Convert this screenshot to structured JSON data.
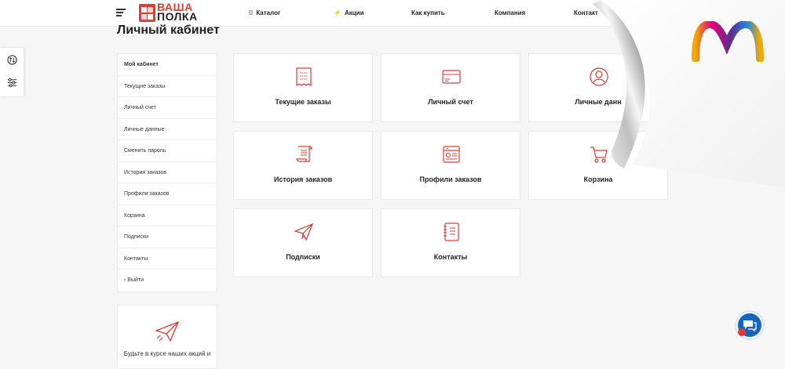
{
  "header": {
    "logo_line1": "ВАША",
    "logo_line2": "ПОЛКА",
    "nav": [
      {
        "label": "Каталог",
        "icon": "grid-icon"
      },
      {
        "label": "Акции",
        "icon": "bolt-icon"
      },
      {
        "label": "Как купить",
        "icon": ""
      },
      {
        "label": "Компания",
        "icon": ""
      },
      {
        "label": "Контакт",
        "icon": ""
      }
    ]
  },
  "page": {
    "title": "Личный кабинет"
  },
  "sidebar": {
    "items": [
      {
        "label": "Мой кабинет",
        "active": true
      },
      {
        "label": "Текущие заказы"
      },
      {
        "label": "Личный счет"
      },
      {
        "label": "Личные данные"
      },
      {
        "label": "Сменить пароль"
      },
      {
        "label": "История заказов"
      },
      {
        "label": "Профили заказов"
      },
      {
        "label": "Корзина"
      },
      {
        "label": "Подписки"
      },
      {
        "label": "Контакты"
      },
      {
        "label": "‹  Выйти"
      }
    ],
    "promo_text": "Будьте в курсе наших акций и"
  },
  "cards": [
    {
      "label": "Текущие заказы",
      "icon": "receipt-icon"
    },
    {
      "label": "Личный счет",
      "icon": "credit-card-icon"
    },
    {
      "label": "Личные данн",
      "icon": "user-icon"
    },
    {
      "label": "История заказов",
      "icon": "scroll-icon"
    },
    {
      "label": "Профили заказов",
      "icon": "profile-card-icon"
    },
    {
      "label": "Корзина",
      "icon": "cart-icon"
    },
    {
      "label": "Подписки",
      "icon": "paper-plane-icon"
    },
    {
      "label": "Контакты",
      "icon": "notebook-icon"
    }
  ],
  "colors": {
    "accent": "#e53935",
    "background": "#f6f6f6"
  }
}
